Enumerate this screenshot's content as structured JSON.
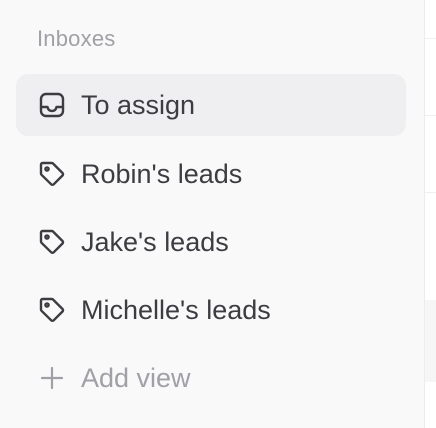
{
  "sidebar": {
    "section_label": "Inboxes",
    "items": [
      {
        "label": "To assign",
        "icon": "inbox-icon",
        "active": true
      },
      {
        "label": "Robin's leads",
        "icon": "tag-icon",
        "active": false
      },
      {
        "label": "Jake's leads",
        "icon": "tag-icon",
        "active": false
      },
      {
        "label": "Michelle's leads",
        "icon": "tag-icon",
        "active": false
      }
    ],
    "add_view": {
      "label": "Add view",
      "icon": "plus-icon"
    }
  },
  "colors": {
    "sidebar_bg": "#f9f9fa",
    "active_item_bg": "#efeff1",
    "text": "#3c3c41",
    "muted_text": "#a0a0a6"
  }
}
